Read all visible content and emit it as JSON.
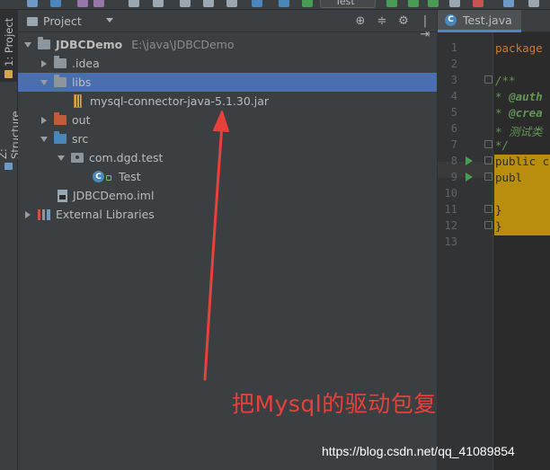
{
  "toolbar": {
    "run_config": "Test"
  },
  "left_strip": {
    "tabs": [
      {
        "label": "1: Project"
      },
      {
        "label": "Z: Structure"
      }
    ]
  },
  "project_panel": {
    "title": "Project",
    "tools": [
      "⊕",
      "≑",
      "⚙",
      "|⇥"
    ]
  },
  "tree": [
    {
      "label": "JDBCDemo",
      "path": "E:\\java\\JDBCDemo",
      "bold": true
    },
    {
      "label": ".idea"
    },
    {
      "label": "libs",
      "selected": true
    },
    {
      "label": "mysql-connector-java-5.1.30.jar"
    },
    {
      "label": "out"
    },
    {
      "label": "src"
    },
    {
      "label": "com.dgd.test"
    },
    {
      "label": "Test"
    },
    {
      "label": "JDBCDemo.iml"
    },
    {
      "label": "External Libraries"
    }
  ],
  "annotation": {
    "text": "把Mysql的驱动包复制过来",
    "color": "#e8403a"
  },
  "editor": {
    "tab_label": "Test.java",
    "line_numbers": [
      "1",
      "2",
      "3",
      "4",
      "5",
      "6",
      "7",
      "8",
      "9",
      "10",
      "11",
      "12",
      "13"
    ],
    "code": {
      "l1": "package c",
      "l3": "/**",
      "l4a": " * ",
      "l4b": "@auth",
      "l5a": " * ",
      "l5b": "@crea",
      "l6": " * 测试类",
      "l7": " */",
      "l8": "public c",
      "l9": "    publ",
      "l11": "    }",
      "l12": "}"
    }
  },
  "watermark": "https://blog.csdn.net/qq_41089854"
}
